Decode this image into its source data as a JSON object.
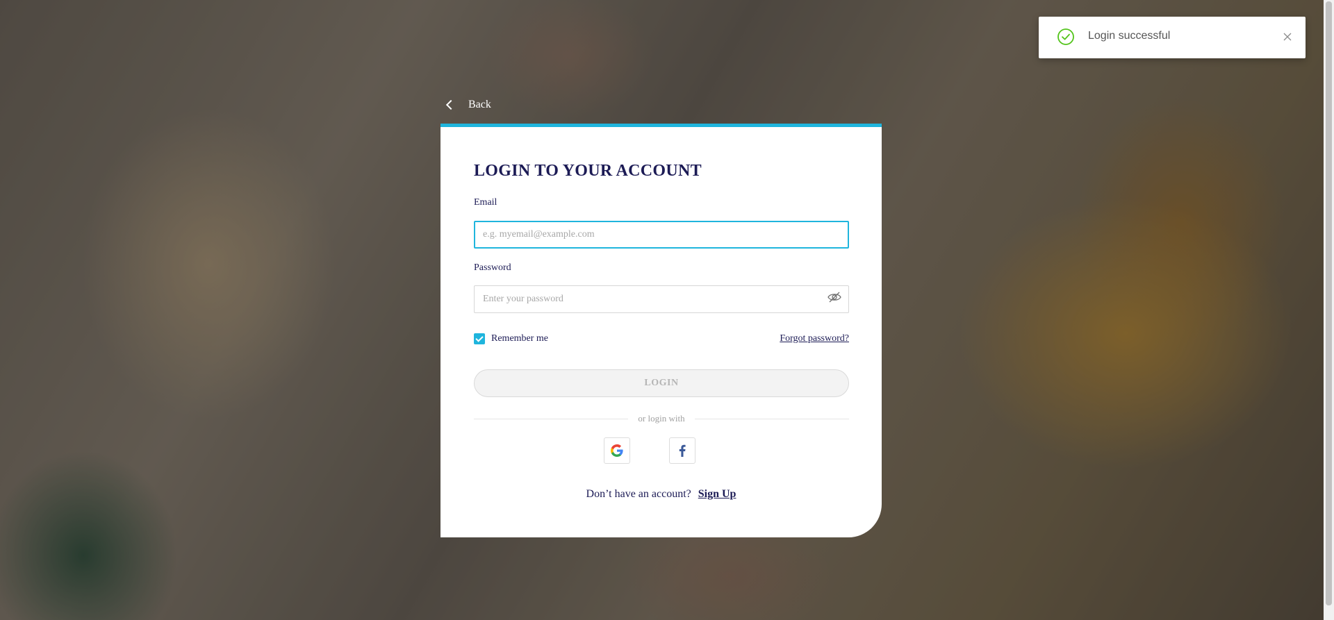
{
  "back": {
    "label": "Back"
  },
  "login_card": {
    "title": "LOGIN TO YOUR ACCOUNT",
    "email": {
      "label": "Email",
      "placeholder": "e.g. myemail@example.com",
      "value": ""
    },
    "password": {
      "label": "Password",
      "placeholder": "Enter your password",
      "value": ""
    },
    "remember_me": {
      "label": "Remember me",
      "checked": true
    },
    "forgot_password": "Forgot password?",
    "login_button": "LOGIN",
    "divider_text": "or login with",
    "social": [
      "google-icon",
      "facebook-icon"
    ],
    "signup_prompt": "Don’t have an account?",
    "signup_link": "Sign Up"
  },
  "toast": {
    "message": "Login successful",
    "icon": "check-circle-icon"
  },
  "colors": {
    "accent": "#1fb5dd",
    "title": "#1c1b55",
    "success": "#52c41a",
    "facebook": "#3b5998"
  }
}
